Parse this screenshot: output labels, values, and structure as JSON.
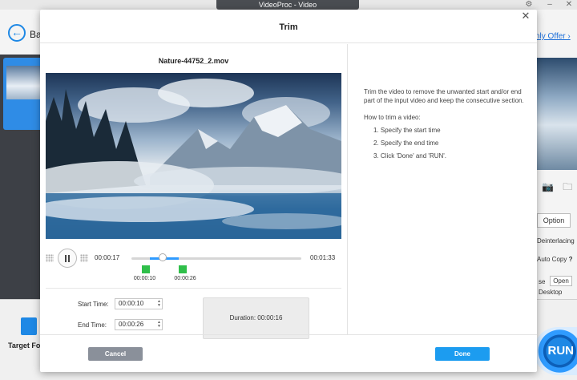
{
  "app": {
    "title": "VideoProc - Video",
    "back_label": "Ba",
    "offer_link": "nly Offer ›",
    "target_format_label": "Target Fo",
    "run_label": "RUN",
    "right_panel": {
      "option_label": "Option",
      "deinterlacing": "Deinterlacing",
      "auto_copy": "Auto Copy",
      "help_mark": "?",
      "se_label": "se",
      "open_label": "Open",
      "desktop_label": "Desktop"
    }
  },
  "dialog": {
    "title": "Trim",
    "filename": "Nature-44752_2.mov",
    "player": {
      "current_time": "00:00:17",
      "total_time": "00:01:33",
      "start_marker": "00:00:10",
      "end_marker": "00:00:26",
      "progress": {
        "start_fraction": 0.108,
        "end_fraction": 0.28,
        "playhead_fraction": 0.183
      }
    },
    "start_time_label": "Start Time:",
    "start_time_value": "00:00:10",
    "end_time_label": "End Time:",
    "end_time_value": "00:00:26",
    "duration_label": "Duration:",
    "duration_value": "00:00:16",
    "help": {
      "intro": "Trim the video to remove the unwanted start and/or end part of the input video and keep the consecutive section.",
      "howto_title": "How to trim a video:",
      "steps": [
        "1. Specify the start time",
        "2. Specify the end time",
        "3. Click 'Done' and 'RUN'."
      ]
    },
    "cancel_label": "Cancel",
    "done_label": "Done"
  },
  "colors": {
    "accent": "#1c9cf0",
    "marker": "#2fbf4a",
    "cancel": "#8a909a"
  }
}
